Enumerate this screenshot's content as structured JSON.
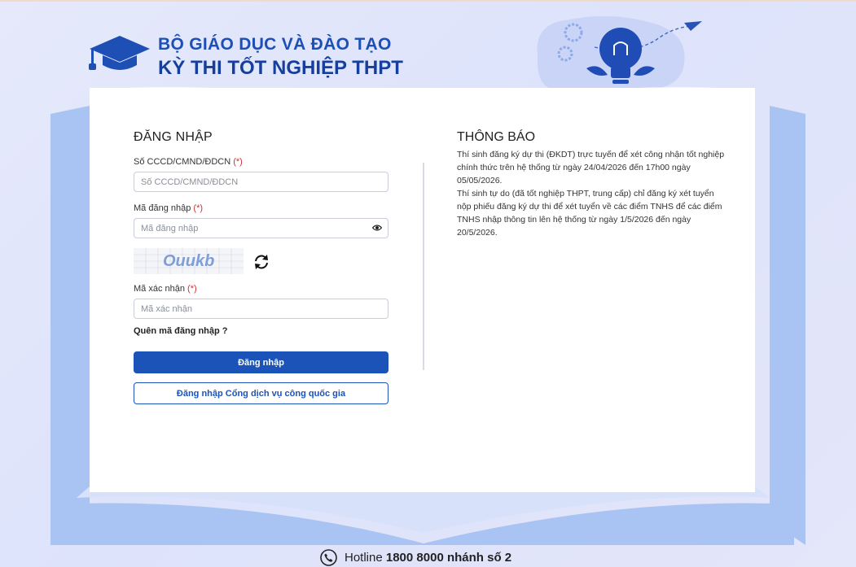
{
  "header": {
    "ministry": "BỘ GIÁO DỤC VÀ ĐÀO TẠO",
    "exam": "KỲ THI TỐT NGHIỆP THPT",
    "logo_icon": "graduation-cap-icon",
    "decor_icon": "lightbulb-gears-icon"
  },
  "login": {
    "title": "ĐĂNG NHẬP",
    "id_label": "Số CCCD/CMND/ĐDCN",
    "id_required": "(*)",
    "id_placeholder": "Số CCCD/CMND/ĐDCN",
    "password_label": "Mã đăng nhập",
    "password_required": "(*)",
    "password_placeholder": "Mã đăng nhập",
    "captcha_text": "Ouukb",
    "captcha_code_label": "Mã xác nhận",
    "captcha_code_required": "(*)",
    "captcha_code_placeholder": "Mã xác nhận",
    "forgot": "Quên mã đăng nhập ?",
    "submit": "Đăng nhập",
    "national_portal": "Đăng nhập Cổng dịch vụ công quốc gia"
  },
  "notice": {
    "title": "THÔNG BÁO",
    "paragraphs": [
      "Thí sinh đăng ký dự thi (ĐKDT) trực tuyến để xét công nhận tốt nghiệp chính thức trên hệ thống từ ngày 24/04/2026 đến 17h00 ngày 05/05/2026.",
      "Thí sinh tự do (đã tốt nghiệp THPT, trung cấp) chỉ đăng ký xét tuyển nộp phiếu đăng ký dự thi để xét tuyển về các điểm TNHS để các điểm TNHS nhập thông tin lên hệ thống từ ngày 1/5/2026 đến ngày 20/5/2026."
    ]
  },
  "footer": {
    "hotline_label": "Hotline",
    "hotline_number": "1800 8000 nhánh số 2"
  },
  "colors": {
    "primary": "#1c53b8",
    "heading": "#163f9d",
    "required": "#d32f2f",
    "book_edge": "#a9c3f2"
  }
}
